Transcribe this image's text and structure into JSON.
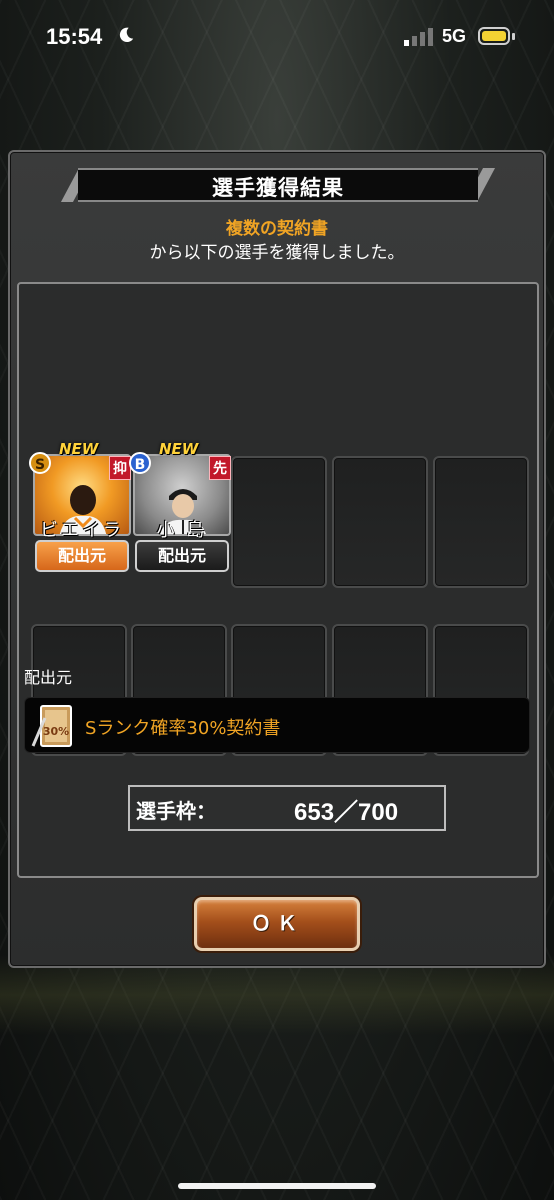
{
  "status_bar": {
    "time": "15:54",
    "network": "5G"
  },
  "dialog": {
    "title": "選手獲得結果",
    "message_highlight": "複数の契約書",
    "message_rest": "から以下の選手を獲得しました。",
    "cards": [
      {
        "new_label": "NEW",
        "rank": "S",
        "position": "抑",
        "name": "ビエイラ",
        "source_label": "配出元"
      },
      {
        "new_label": "NEW",
        "rank": "B",
        "position": "先",
        "name": "小 島",
        "source_label": "配出元"
      }
    ],
    "source_section_label": "配出元",
    "contract": {
      "icon_text": "30%",
      "name": "Sランク確率30%契約書"
    },
    "slots": {
      "label": "選手枠：",
      "value": "653／700"
    },
    "ok_label": "ＯＫ"
  }
}
